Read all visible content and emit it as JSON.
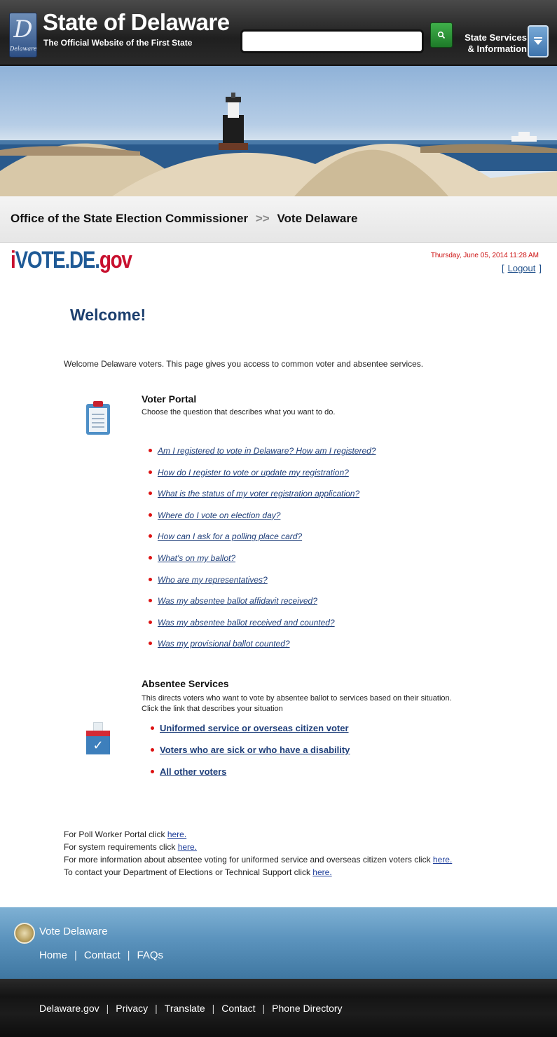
{
  "header": {
    "seal_letter": "D",
    "seal_word": "Delaware",
    "title": "State of Delaware",
    "subtitle": "The Official Website of the First State",
    "search_value": "",
    "services_line1": "State Services",
    "services_line2": "& Information",
    "icons": [
      "search-icon",
      "chevron-down-icon"
    ]
  },
  "breadcrumb": {
    "item1": "Office of the State Election Commissioner",
    "separator": ">>",
    "item2": "Vote Delaware"
  },
  "brand": {
    "i": "i",
    "vote": "VOTE.DE.",
    "gov": "gov"
  },
  "datestamp": "Thursday, June 05, 2014 11:28 AM",
  "logout": {
    "open": "[",
    "label": "Logout",
    "close": "]"
  },
  "welcome": {
    "title": "Welcome!",
    "text": "Welcome Delaware voters. This page gives you access to common voter and absentee services."
  },
  "voter_portal": {
    "title": "Voter Portal",
    "description": "Choose the question that describes what you want to do.",
    "links": [
      "Am I registered to vote in Delaware? How am I registered?",
      "How do I register to vote or update my registration?",
      "What is the status of my voter registration application?",
      "Where do I vote on election day?",
      "How can I ask for a polling place card?",
      "What's on my ballot?",
      "Who are my representatives?",
      "Was my absentee ballot affidavit received?",
      "Was my absentee ballot received and counted?",
      "Was my provisional ballot counted?"
    ]
  },
  "absentee": {
    "title": "Absentee Services",
    "description1": "This directs voters who want to vote by absentee ballot to services based on their situation.",
    "description2": "Click the link that describes your situation",
    "links": [
      "Uniformed service or overseas citizen voter",
      "Voters who are sick or who have a disability",
      "All other voters"
    ],
    "check_glyph": "✓"
  },
  "info_lines": [
    {
      "text": "For Poll Worker Portal click ",
      "link": "here."
    },
    {
      "text": "For system requirements click ",
      "link": "here."
    },
    {
      "text": "For more information about absentee voting for uniformed service and overseas citizen voters click ",
      "link": "here."
    },
    {
      "text": "To contact your Department of Elections or Technical Support click ",
      "link": "here."
    }
  ],
  "vote_footer": {
    "brand": "Vote Delaware",
    "nav": [
      "Home",
      "Contact",
      "FAQs"
    ],
    "separator": "|"
  },
  "bottom_nav": {
    "items": [
      "Delaware.gov",
      "Privacy",
      "Translate",
      "Contact",
      "Phone Directory"
    ],
    "separator": "|"
  },
  "colors": {
    "header_bg": "#2a2a2a",
    "search_button": "#2e9a3a",
    "services_button": "#5b8fc4",
    "brand_red": "#c8102e",
    "brand_blue": "#1f5a96",
    "link": "#1f3f7a",
    "footer_blue": "#5b93bd"
  }
}
